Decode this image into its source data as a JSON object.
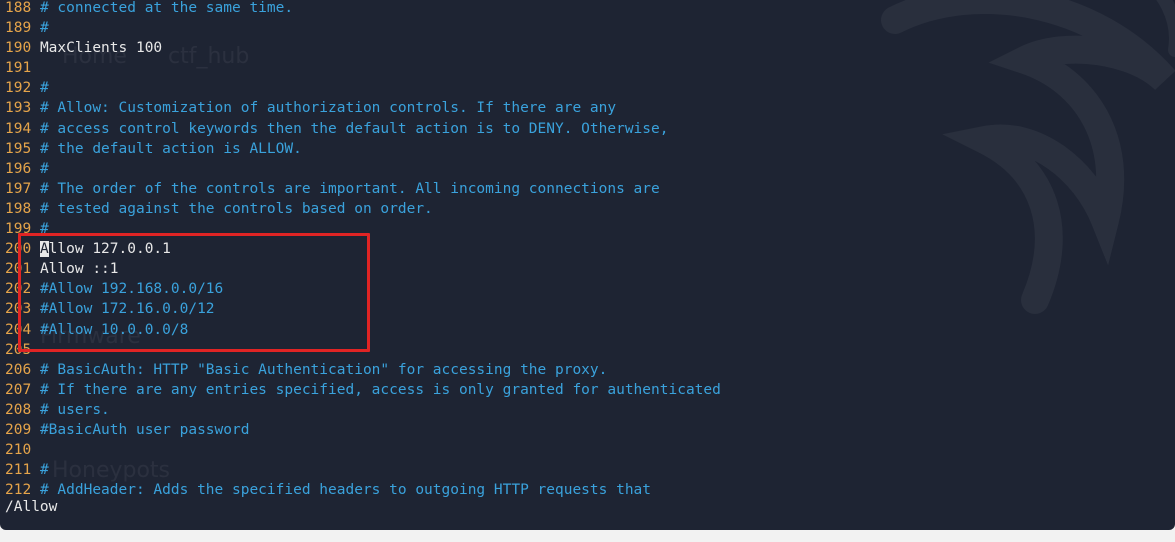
{
  "editor": {
    "lines": [
      {
        "num": "188",
        "text": "# connected at the same time.",
        "kind": "comment"
      },
      {
        "num": "189",
        "text": "#",
        "kind": "comment"
      },
      {
        "num": "190",
        "text": "MaxClients 100",
        "kind": "code"
      },
      {
        "num": "191",
        "text": "",
        "kind": "comment"
      },
      {
        "num": "192",
        "text": "#",
        "kind": "comment"
      },
      {
        "num": "193",
        "text": "# Allow: Customization of authorization controls. If there are any",
        "kind": "comment"
      },
      {
        "num": "194",
        "text": "# access control keywords then the default action is to DENY. Otherwise,",
        "kind": "comment"
      },
      {
        "num": "195",
        "text": "# the default action is ALLOW.",
        "kind": "comment"
      },
      {
        "num": "196",
        "text": "#",
        "kind": "comment"
      },
      {
        "num": "197",
        "text": "# The order of the controls are important. All incoming connections are",
        "kind": "comment"
      },
      {
        "num": "198",
        "text": "# tested against the controls based on order.",
        "kind": "comment"
      },
      {
        "num": "199",
        "text": "#",
        "kind": "comment"
      },
      {
        "num": "200",
        "text": "Allow 127.0.0.1",
        "kind": "code",
        "cursor": true
      },
      {
        "num": "201",
        "text": "Allow ::1",
        "kind": "code"
      },
      {
        "num": "202",
        "text": "#Allow 192.168.0.0/16",
        "kind": "comment"
      },
      {
        "num": "203",
        "text": "#Allow 172.16.0.0/12",
        "kind": "comment"
      },
      {
        "num": "204",
        "text": "#Allow 10.0.0.0/8",
        "kind": "comment"
      },
      {
        "num": "205",
        "text": "",
        "kind": "comment"
      },
      {
        "num": "206",
        "text": "# BasicAuth: HTTP \"Basic Authentication\" for accessing the proxy.",
        "kind": "comment"
      },
      {
        "num": "207",
        "text": "# If there are any entries specified, access is only granted for authenticated",
        "kind": "comment"
      },
      {
        "num": "208",
        "text": "# users.",
        "kind": "comment"
      },
      {
        "num": "209",
        "text": "#BasicAuth user password",
        "kind": "comment"
      },
      {
        "num": "210",
        "text": "",
        "kind": "comment"
      },
      {
        "num": "211",
        "text": "#",
        "kind": "comment"
      },
      {
        "num": "212",
        "text": "# AddHeader: Adds the specified headers to outgoing HTTP requests that",
        "kind": "comment"
      }
    ],
    "command_line": "/Allow"
  },
  "wallpaper": {
    "ghost_labels": [
      "Home",
      "ctf_hub",
      "Firmware",
      "Honeypots"
    ]
  },
  "colors": {
    "background": "#1e2433",
    "line_number": "#e5a44a",
    "comment": "#3aa2dc",
    "code": "#e8e8e8",
    "highlight": "#e02424"
  }
}
